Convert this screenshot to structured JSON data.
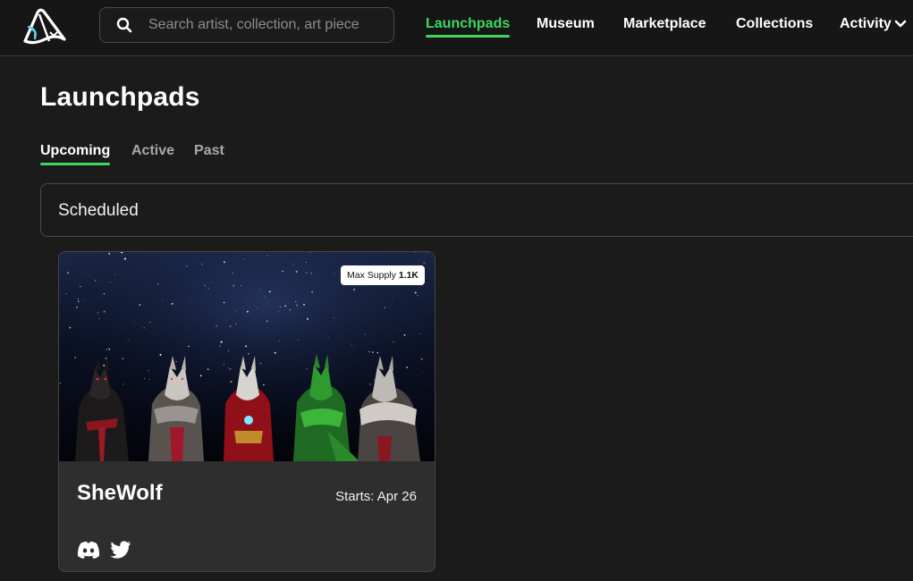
{
  "header": {
    "search_placeholder": "Search artist, collection, art piece",
    "nav": [
      {
        "label": "Launchpads",
        "active": true
      },
      {
        "label": "Museum"
      },
      {
        "label": "Marketplace"
      },
      {
        "label": "Collections"
      },
      {
        "label": "Activity"
      }
    ]
  },
  "page": {
    "title": "Launchpads",
    "tabs": [
      "Upcoming",
      "Active",
      "Past"
    ],
    "active_tab": "Upcoming",
    "section_label": "Scheduled"
  },
  "card": {
    "title": "SheWolf",
    "start_label": "Starts: Apr 26",
    "supply_label": "Max Supply",
    "supply_value": "1.1K",
    "socials": [
      "discord-icon",
      "twitter-icon"
    ]
  },
  "colors": {
    "accent": "#3fd65f",
    "background": "#1b1b1b",
    "card": "#2e2e2e"
  }
}
